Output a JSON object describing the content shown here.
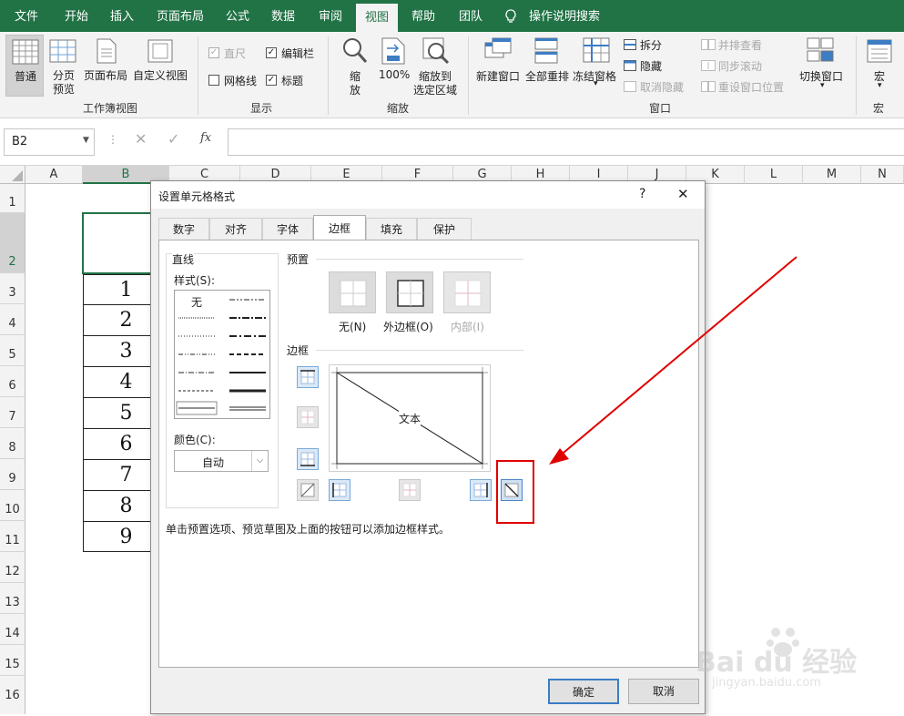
{
  "ribbon_tabs": [
    "文件",
    "开始",
    "插入",
    "页面布局",
    "公式",
    "数据",
    "审阅",
    "视图",
    "帮助",
    "团队",
    "操作说明搜索"
  ],
  "active_tab": "视图",
  "ribbon": {
    "normal": "普通",
    "page_break_1": "分页",
    "page_break_2": "预览",
    "page_layout": "页面布局",
    "custom_view": "自定义视图",
    "group_workbook_views": "工作簿视图",
    "ruler": "直尺",
    "formula_bar": "编辑栏",
    "gridlines": "网格线",
    "headings": "标题",
    "group_show": "显示",
    "zoom_1": "缩",
    "zoom_2": "放",
    "zoom100": "100%",
    "zoom_sel_1": "缩放到",
    "zoom_sel_2": "选定区域",
    "group_zoom": "缩放",
    "new_window": "新建窗口",
    "arrange_all": "全部重排",
    "freeze": "冻结窗格",
    "split": "拆分",
    "hide": "隐藏",
    "unhide": "取消隐藏",
    "side_by_side": "并排查看",
    "sync_scroll": "同步滚动",
    "reset_pos": "重设窗口位置",
    "switch": "切换窗口",
    "group_window": "窗口",
    "macros": "宏",
    "group_macros": "宏"
  },
  "formula_bar": {
    "name_box": "B2",
    "fx": "fx",
    "value": ""
  },
  "columns": [
    "A",
    "B",
    "C",
    "D",
    "E",
    "F",
    "G",
    "H",
    "I",
    "J",
    "K",
    "L",
    "M",
    "N"
  ],
  "rows": [
    "1",
    "2",
    "3",
    "4",
    "5",
    "6",
    "7",
    "8",
    "9",
    "10",
    "11",
    "12",
    "13",
    "14",
    "15",
    "16"
  ],
  "cell_values": [
    "1",
    "2",
    "3",
    "4",
    "5",
    "6",
    "7",
    "8",
    "9"
  ],
  "dialog": {
    "title": "设置单元格格式",
    "help": "?",
    "close": "✕",
    "tabs": [
      "数字",
      "对齐",
      "字体",
      "边框",
      "填充",
      "保护"
    ],
    "active_tab": "边框",
    "line_section": "直线",
    "style_label": "样式(S):",
    "style_none": "无",
    "color_label": "颜色(C):",
    "color_value": "自动",
    "preset_section": "预置",
    "preset_none": "无(N)",
    "preset_outline": "外边框(O)",
    "preset_inside": "内部(I)",
    "border_section": "边框",
    "preview_text": "文本",
    "hint": "单击预置选项、预览草图及上面的按钮可以添加边框样式。",
    "ok": "确定",
    "cancel": "取消"
  },
  "watermark": {
    "brand": "Bai du 经验",
    "url": "jingyan.baidu.com"
  },
  "colors": {
    "excel_green": "#217346",
    "highlight_red": "#e00000"
  }
}
